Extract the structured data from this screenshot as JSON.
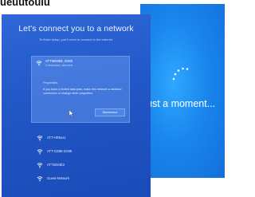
{
  "top_caption": "ueuutouiu",
  "left_screen": {
    "title": "Let's connect you to a network",
    "subtitle": "To finish setup, you'll need to connect to the internet.",
    "selected_network": {
      "name": "ATT6060k8, 2G89",
      "status": "Connected, secured",
      "heading": "Properties",
      "description": "If you have a limited data plan, make this network a metered connection or change other properties.",
      "button_label": "Disconnect"
    },
    "networks": [
      {
        "name": "ATT-HR5xxx"
      },
      {
        "name": "ATT-CD88-2G89"
      },
      {
        "name": "ATT6294E2"
      },
      {
        "name": "Guest-Network"
      }
    ]
  },
  "right_screen": {
    "message": "ust a moment..."
  },
  "colors": {
    "left_bg": "#2358c8",
    "right_bg": "#1a86ee",
    "text": "#ffffff"
  }
}
